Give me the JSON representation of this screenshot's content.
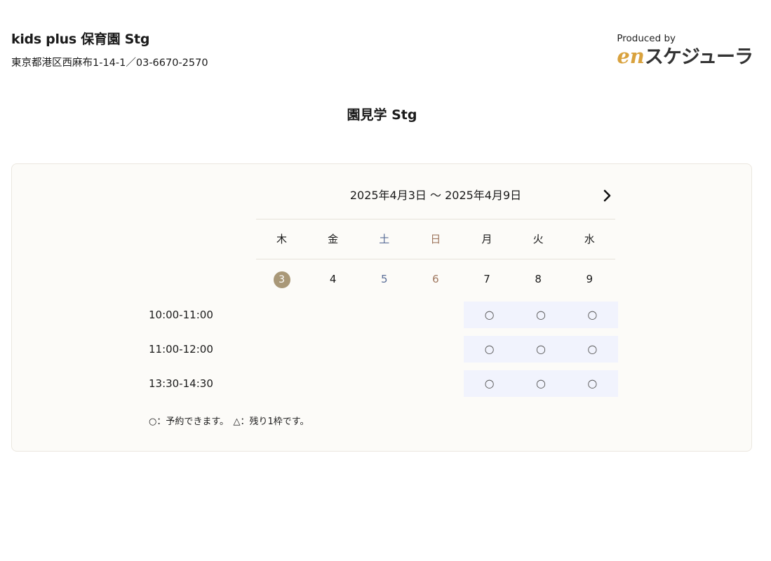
{
  "facility": {
    "name": "kids plus 保育園 Stg",
    "address_phone": "東京都港区西麻布1-14-1／03-6670-2570"
  },
  "brand": {
    "produced_by": "Produced by",
    "logo_en": "en",
    "logo_rest": "スケジューラ",
    "accent_color": "#d9a23e"
  },
  "event": {
    "title": "園見学 Stg"
  },
  "calendar": {
    "range": "2025年4月3日 〜 2025年4月9日",
    "next_icon": "chevron-right-icon",
    "days": [
      {
        "dow": "木",
        "date": "3",
        "kind": "today"
      },
      {
        "dow": "金",
        "date": "4",
        "kind": "weekday"
      },
      {
        "dow": "土",
        "date": "5",
        "kind": "saturday"
      },
      {
        "dow": "日",
        "date": "6",
        "kind": "sunday"
      },
      {
        "dow": "月",
        "date": "7",
        "kind": "weekday"
      },
      {
        "dow": "火",
        "date": "8",
        "kind": "weekday"
      },
      {
        "dow": "水",
        "date": "9",
        "kind": "weekday"
      }
    ],
    "colors": {
      "saturday": "#5a6e98",
      "sunday": "#a07860",
      "today_badge": "#a99878",
      "available_band": "#f1f3fd"
    },
    "slots": [
      {
        "time": "10:00-11:00",
        "availability": [
          "",
          "",
          "",
          "",
          "○",
          "○",
          "○"
        ]
      },
      {
        "time": "11:00-12:00",
        "availability": [
          "",
          "",
          "",
          "",
          "○",
          "○",
          "○"
        ]
      },
      {
        "time": "13:30-14:30",
        "availability": [
          "",
          "",
          "",
          "",
          "○",
          "○",
          "○"
        ]
      }
    ],
    "legend": "○：予約できます。　△：残り1枠です。"
  }
}
